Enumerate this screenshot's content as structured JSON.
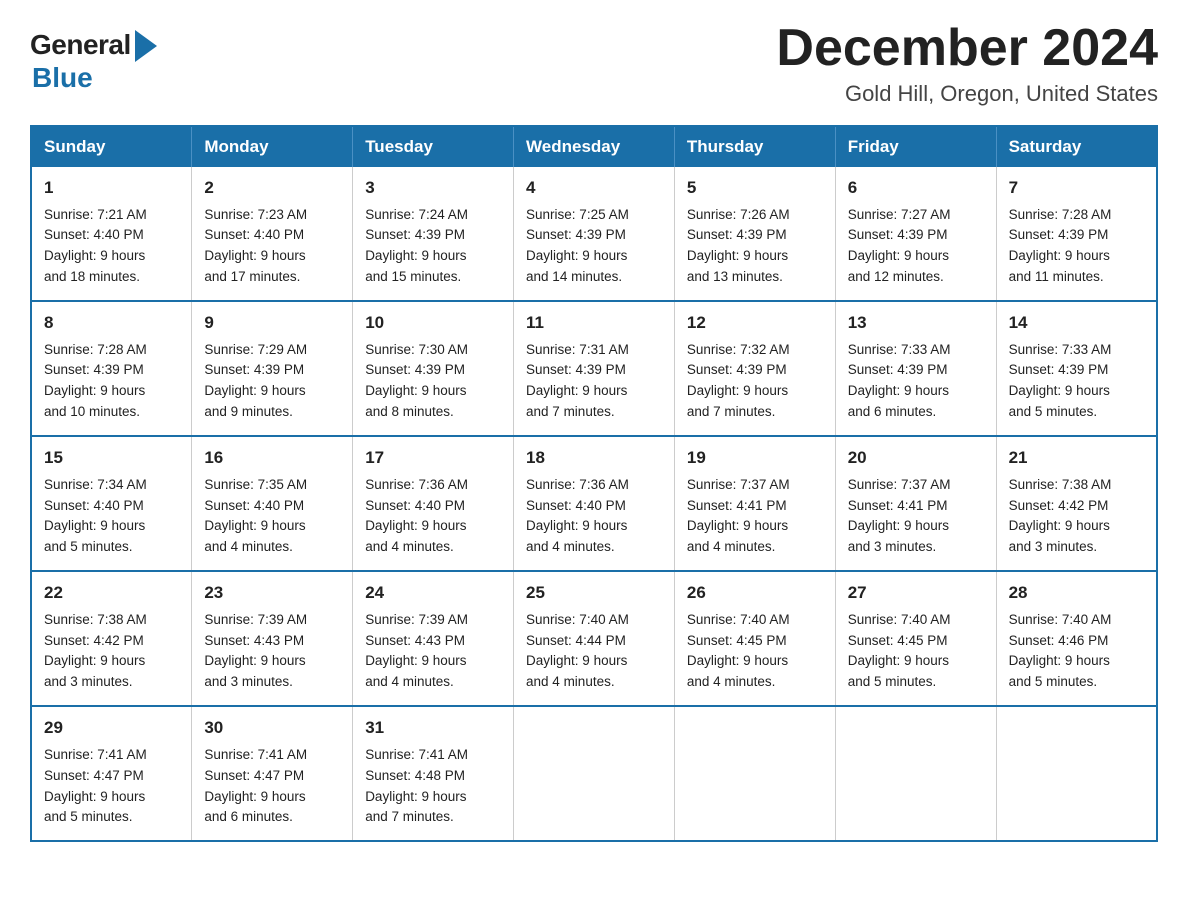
{
  "logo": {
    "general": "General",
    "blue": "Blue"
  },
  "header": {
    "month_title": "December 2024",
    "location": "Gold Hill, Oregon, United States"
  },
  "days_of_week": [
    "Sunday",
    "Monday",
    "Tuesday",
    "Wednesday",
    "Thursday",
    "Friday",
    "Saturday"
  ],
  "weeks": [
    [
      {
        "day": "1",
        "sunrise": "7:21 AM",
        "sunset": "4:40 PM",
        "daylight": "9 hours and 18 minutes."
      },
      {
        "day": "2",
        "sunrise": "7:23 AM",
        "sunset": "4:40 PM",
        "daylight": "9 hours and 17 minutes."
      },
      {
        "day": "3",
        "sunrise": "7:24 AM",
        "sunset": "4:39 PM",
        "daylight": "9 hours and 15 minutes."
      },
      {
        "day": "4",
        "sunrise": "7:25 AM",
        "sunset": "4:39 PM",
        "daylight": "9 hours and 14 minutes."
      },
      {
        "day": "5",
        "sunrise": "7:26 AM",
        "sunset": "4:39 PM",
        "daylight": "9 hours and 13 minutes."
      },
      {
        "day": "6",
        "sunrise": "7:27 AM",
        "sunset": "4:39 PM",
        "daylight": "9 hours and 12 minutes."
      },
      {
        "day": "7",
        "sunrise": "7:28 AM",
        "sunset": "4:39 PM",
        "daylight": "9 hours and 11 minutes."
      }
    ],
    [
      {
        "day": "8",
        "sunrise": "7:28 AM",
        "sunset": "4:39 PM",
        "daylight": "9 hours and 10 minutes."
      },
      {
        "day": "9",
        "sunrise": "7:29 AM",
        "sunset": "4:39 PM",
        "daylight": "9 hours and 9 minutes."
      },
      {
        "day": "10",
        "sunrise": "7:30 AM",
        "sunset": "4:39 PM",
        "daylight": "9 hours and 8 minutes."
      },
      {
        "day": "11",
        "sunrise": "7:31 AM",
        "sunset": "4:39 PM",
        "daylight": "9 hours and 7 minutes."
      },
      {
        "day": "12",
        "sunrise": "7:32 AM",
        "sunset": "4:39 PM",
        "daylight": "9 hours and 7 minutes."
      },
      {
        "day": "13",
        "sunrise": "7:33 AM",
        "sunset": "4:39 PM",
        "daylight": "9 hours and 6 minutes."
      },
      {
        "day": "14",
        "sunrise": "7:33 AM",
        "sunset": "4:39 PM",
        "daylight": "9 hours and 5 minutes."
      }
    ],
    [
      {
        "day": "15",
        "sunrise": "7:34 AM",
        "sunset": "4:40 PM",
        "daylight": "9 hours and 5 minutes."
      },
      {
        "day": "16",
        "sunrise": "7:35 AM",
        "sunset": "4:40 PM",
        "daylight": "9 hours and 4 minutes."
      },
      {
        "day": "17",
        "sunrise": "7:36 AM",
        "sunset": "4:40 PM",
        "daylight": "9 hours and 4 minutes."
      },
      {
        "day": "18",
        "sunrise": "7:36 AM",
        "sunset": "4:40 PM",
        "daylight": "9 hours and 4 minutes."
      },
      {
        "day": "19",
        "sunrise": "7:37 AM",
        "sunset": "4:41 PM",
        "daylight": "9 hours and 4 minutes."
      },
      {
        "day": "20",
        "sunrise": "7:37 AM",
        "sunset": "4:41 PM",
        "daylight": "9 hours and 3 minutes."
      },
      {
        "day": "21",
        "sunrise": "7:38 AM",
        "sunset": "4:42 PM",
        "daylight": "9 hours and 3 minutes."
      }
    ],
    [
      {
        "day": "22",
        "sunrise": "7:38 AM",
        "sunset": "4:42 PM",
        "daylight": "9 hours and 3 minutes."
      },
      {
        "day": "23",
        "sunrise": "7:39 AM",
        "sunset": "4:43 PM",
        "daylight": "9 hours and 3 minutes."
      },
      {
        "day": "24",
        "sunrise": "7:39 AM",
        "sunset": "4:43 PM",
        "daylight": "9 hours and 4 minutes."
      },
      {
        "day": "25",
        "sunrise": "7:40 AM",
        "sunset": "4:44 PM",
        "daylight": "9 hours and 4 minutes."
      },
      {
        "day": "26",
        "sunrise": "7:40 AM",
        "sunset": "4:45 PM",
        "daylight": "9 hours and 4 minutes."
      },
      {
        "day": "27",
        "sunrise": "7:40 AM",
        "sunset": "4:45 PM",
        "daylight": "9 hours and 5 minutes."
      },
      {
        "day": "28",
        "sunrise": "7:40 AM",
        "sunset": "4:46 PM",
        "daylight": "9 hours and 5 minutes."
      }
    ],
    [
      {
        "day": "29",
        "sunrise": "7:41 AM",
        "sunset": "4:47 PM",
        "daylight": "9 hours and 5 minutes."
      },
      {
        "day": "30",
        "sunrise": "7:41 AM",
        "sunset": "4:47 PM",
        "daylight": "9 hours and 6 minutes."
      },
      {
        "day": "31",
        "sunrise": "7:41 AM",
        "sunset": "4:48 PM",
        "daylight": "9 hours and 7 minutes."
      },
      null,
      null,
      null,
      null
    ]
  ],
  "labels": {
    "sunrise": "Sunrise:",
    "sunset": "Sunset:",
    "daylight": "Daylight:"
  }
}
